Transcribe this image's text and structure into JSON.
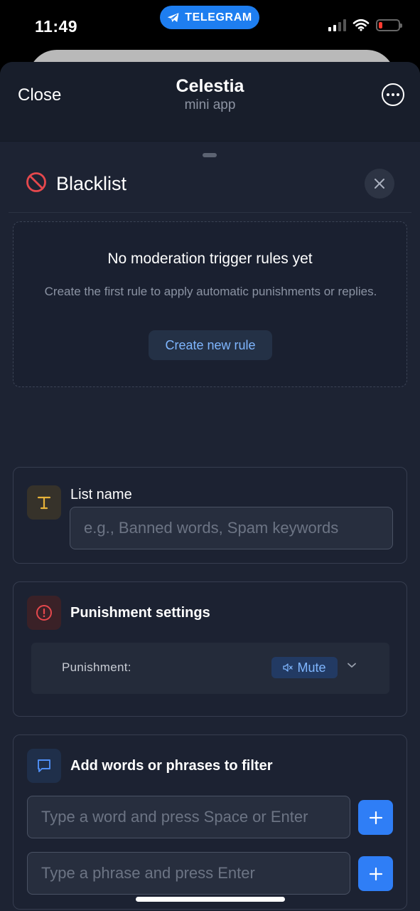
{
  "status_bar": {
    "time": "11:49",
    "pill_label": "TELEGRAM",
    "pill_color": "#1e7ef0"
  },
  "header": {
    "close_label": "Close",
    "title": "Celestia",
    "subtitle": "mini app",
    "more_icon": "more-icon"
  },
  "blacklist": {
    "title": "Blacklist",
    "icon": "prohibited-icon",
    "icon_color": "#e5484d"
  },
  "empty_state": {
    "title": "No moderation trigger rules yet",
    "description": "Create the first rule to apply automatic punishments or replies.",
    "button_label": "Create new rule"
  },
  "list_name": {
    "label": "List name",
    "icon": "text-icon",
    "placeholder": "e.g., Banned words, Spam keywords",
    "value": ""
  },
  "punishment": {
    "title": "Punishment settings",
    "icon": "alert-circle-icon",
    "row_label": "Punishment:",
    "selected": "Mute",
    "selected_icon": "mute-icon"
  },
  "filters": {
    "title": "Add words or phrases to filter",
    "icon": "chat-icon",
    "word_placeholder": "Type a word and press Space or Enter",
    "phrase_placeholder": "Type a phrase and press Enter",
    "accent": "#2f7ef6"
  }
}
